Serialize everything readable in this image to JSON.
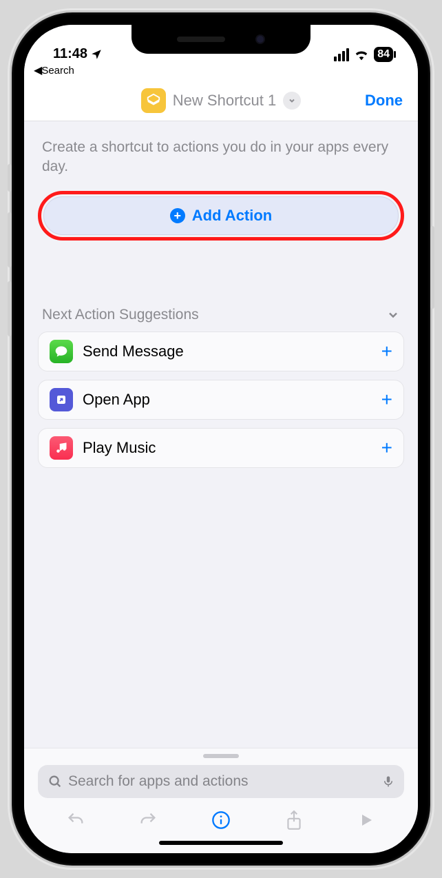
{
  "status": {
    "time": "11:48",
    "battery_percent": "84",
    "breadcrumb_label": "Search"
  },
  "header": {
    "title": "New Shortcut 1",
    "done_label": "Done"
  },
  "content": {
    "description": "Create a shortcut to actions you do in your apps every day.",
    "add_action_label": "Add Action"
  },
  "suggestions": {
    "header": "Next Action Suggestions",
    "items": [
      {
        "label": "Send Message",
        "icon": "messages"
      },
      {
        "label": "Open App",
        "icon": "shortcuts"
      },
      {
        "label": "Play Music",
        "icon": "music"
      }
    ]
  },
  "search": {
    "placeholder": "Search for apps and actions"
  }
}
